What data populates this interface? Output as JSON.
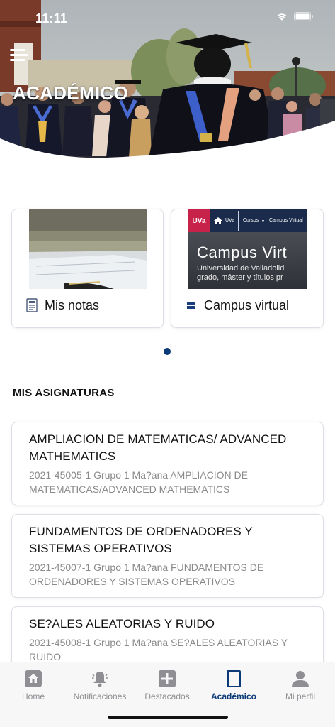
{
  "status_bar": {
    "time": "11:11"
  },
  "header": {
    "title": "ACADÉMICO"
  },
  "quick_links": [
    {
      "label": "Mis notas",
      "icon": "document-icon"
    },
    {
      "label": "Campus virtual",
      "icon": "list-icon"
    }
  ],
  "campus_preview": {
    "logo": "UVa",
    "nav_home": "UVa",
    "nav_courses": "Cursos",
    "nav_campus": "Campus Virtual",
    "headline": "Campus Virt",
    "line1": "Universidad de Valladolid",
    "line2": "grado, máster y títulos pr"
  },
  "section": {
    "title": "MIS ASIGNATURAS"
  },
  "subjects": [
    {
      "title": "AMPLIACION DE MATEMATICAS/ ADVANCED MATHEMATICS",
      "subtitle": "2021-45005-1 Grupo 1 Ma?ana AMPLIACION DE MATEMATICAS/ADVANCED MATHEMATICS"
    },
    {
      "title": "FUNDAMENTOS DE ORDENADORES Y SISTEMAS OPERATIVOS",
      "subtitle": "2021-45007-1 Grupo 1 Ma?ana FUNDAMENTOS DE ORDENADORES Y SISTEMAS OPERATIVOS"
    },
    {
      "title": "SE?ALES ALEATORIAS Y RUIDO",
      "subtitle": "2021-45008-1 Grupo 1 Ma?ana SE?ALES ALEATORIAS Y RUIDO"
    }
  ],
  "tabs": [
    {
      "label": "Home",
      "icon": "home-icon"
    },
    {
      "label": "Notificaciones",
      "icon": "bell-icon"
    },
    {
      "label": "Destacados",
      "icon": "plus-box-icon"
    },
    {
      "label": "Académico",
      "icon": "book-icon",
      "active": true
    },
    {
      "label": "Mi perfil",
      "icon": "person-icon"
    }
  ],
  "colors": {
    "accent": "#0c3a76",
    "inactive": "#8e8e93",
    "campus_red": "#c6224a",
    "campus_navy": "#1a2b4c"
  }
}
